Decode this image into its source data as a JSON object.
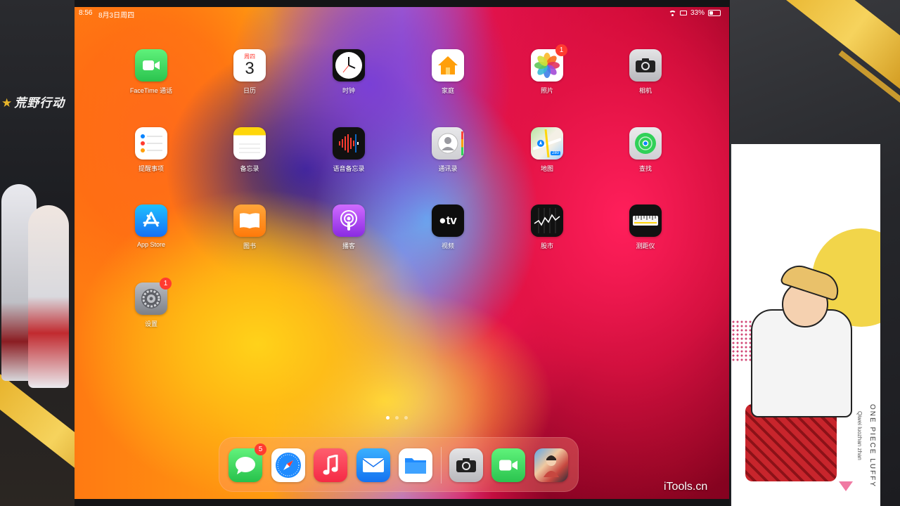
{
  "status_bar": {
    "time": "8:56",
    "date": "8月3日周四",
    "battery_text": "33%",
    "battery_level": 0.33
  },
  "overlay": {
    "game_logo": "荒野行动",
    "poster_title": "ONE PIECE LUFFY",
    "poster_subtitle": "Qiwei luozhan zhan"
  },
  "home_screen": {
    "apps": [
      {
        "label": "FaceTime 通话",
        "icon": "facetime-icon"
      },
      {
        "label": "日历",
        "icon": "calendar-icon",
        "weekday": "周四",
        "day": "3"
      },
      {
        "label": "时钟",
        "icon": "clock-icon"
      },
      {
        "label": "家庭",
        "icon": "home-icon"
      },
      {
        "label": "照片",
        "icon": "photos-icon",
        "badge": "1"
      },
      {
        "label": "相机",
        "icon": "camera-icon"
      },
      {
        "label": "提醒事项",
        "icon": "reminders-icon"
      },
      {
        "label": "备忘录",
        "icon": "notes-icon"
      },
      {
        "label": "语音备忘录",
        "icon": "voice-memos-icon"
      },
      {
        "label": "通讯录",
        "icon": "contacts-icon"
      },
      {
        "label": "地图",
        "icon": "maps-icon",
        "sign": "280"
      },
      {
        "label": "查找",
        "icon": "find-my-icon"
      },
      {
        "label": "App Store",
        "icon": "app-store-icon"
      },
      {
        "label": "图书",
        "icon": "books-icon"
      },
      {
        "label": "播客",
        "icon": "podcasts-icon"
      },
      {
        "label": "视频",
        "icon": "tv-icon",
        "glyph": "tv"
      },
      {
        "label": "股市",
        "icon": "stocks-icon"
      },
      {
        "label": "测距仪",
        "icon": "measure-icon"
      },
      {
        "label": "设置",
        "icon": "settings-icon",
        "badge": "1"
      }
    ],
    "pages": 3,
    "current_page": 1
  },
  "dock": {
    "apps": [
      {
        "icon": "messages-icon",
        "badge": "5"
      },
      {
        "icon": "safari-icon"
      },
      {
        "icon": "music-icon"
      },
      {
        "icon": "mail-icon"
      },
      {
        "icon": "files-icon"
      },
      {
        "icon": "camera-icon"
      },
      {
        "icon": "facetime-icon"
      },
      {
        "icon": "game-app-icon"
      }
    ]
  },
  "watermark": "iTools.cn",
  "colors": {
    "badge": "#ff3b30",
    "facetime": "#2fd158",
    "stripe": "#e7b22b"
  }
}
